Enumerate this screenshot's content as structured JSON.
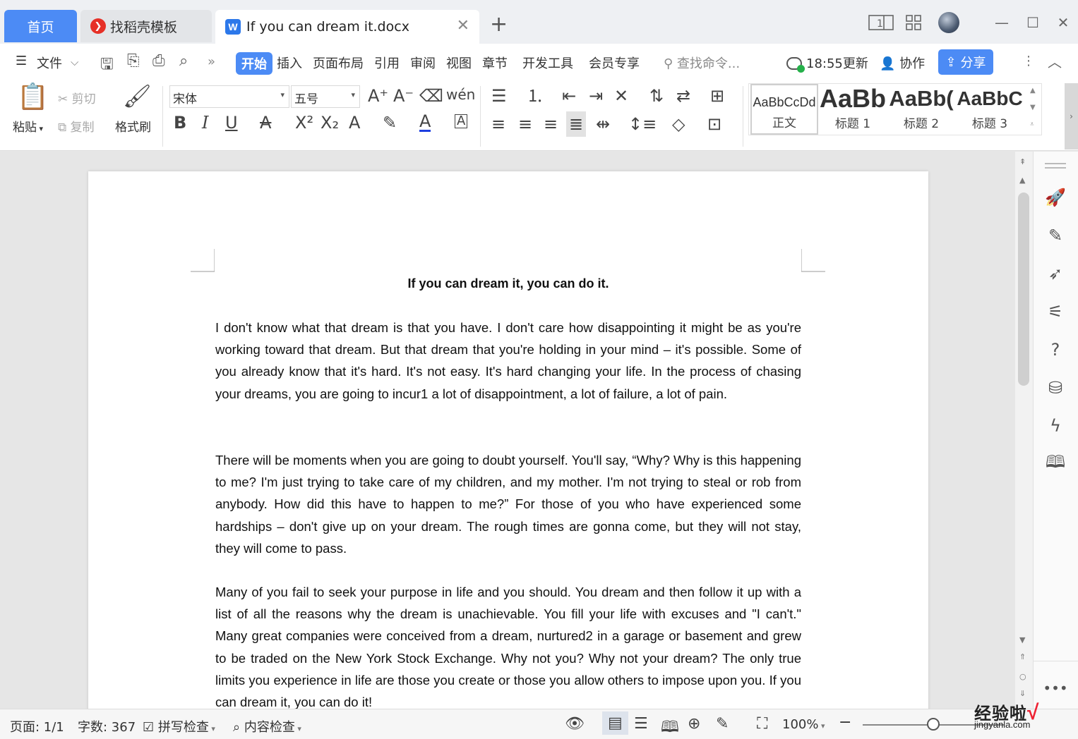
{
  "tabs": {
    "home": "首页",
    "template": "找稻壳模板",
    "document": "If you can dream it.docx"
  },
  "menu": {
    "file": "文件",
    "items": [
      "开始",
      "插入",
      "页面布局",
      "引用",
      "审阅",
      "视图",
      "章节",
      "开发工具",
      "会员专享"
    ],
    "search_placeholder": "查找命令...",
    "update_status": "18:55更新",
    "collaborate": "协作",
    "share": "分享"
  },
  "ribbon": {
    "paste": "粘贴",
    "cut": "剪切",
    "copy": "复制",
    "format_painter": "格式刷",
    "font_name": "宋体",
    "font_size": "五号",
    "styles": [
      {
        "preview": "AaBbCcDd",
        "label": "正文"
      },
      {
        "preview": "AaBb",
        "label": "标题 1"
      },
      {
        "preview": "AaBb(",
        "label": "标题 2"
      },
      {
        "preview": "AaBbC",
        "label": "标题 3"
      }
    ]
  },
  "document": {
    "title": "If you can dream it, you can do it.",
    "paragraphs": [
      "I don't know what that dream is that you have. I don't care how disappointing it might be as you're working toward that dream. But that dream that you're holding in your mind – it's possible. Some of you already know that it's hard. It's not easy. It's hard changing your life. In the process of chasing your dreams, you are going to incur1 a lot of disappointment, a lot of failure, a lot of pain.",
      "There will be moments when you are going to doubt yourself. You'll say, “Why? Why is this happening to me? I'm just trying to take care of my children, and my mother. I'm not trying to steal or rob from anybody. How did this have to happen to me?” For those of you who have experienced some hardships – don't give up on your dream. The rough times are gonna come, but they will not stay, they will come to pass.",
      "Many of you fail to seek your purpose in life and you should. You dream and then follow it up with a list of all the reasons why the dream is unachievable. You fill your life with excuses and \"I can't.\" Many great companies were conceived from a dream, nurtured2 in a garage or basement and grew to be traded on the New York Stock Exchange. Why not you? Why not your dream? The only true limits you experience in life are those you create or those you allow others to impose upon you. If you can dream it, you can do it!"
    ]
  },
  "status": {
    "page": "页面: 1/1",
    "word_count": "字数: 367",
    "spell_check": "拼写检查",
    "content_check": "内容检查",
    "zoom": "100%",
    "zoom_level": 0.5
  },
  "watermark": {
    "top": "经验啦",
    "bottom": "jingyanla.com"
  },
  "colors": {
    "accent": "#4c8bf5",
    "sync_ok": "#25b04a"
  }
}
